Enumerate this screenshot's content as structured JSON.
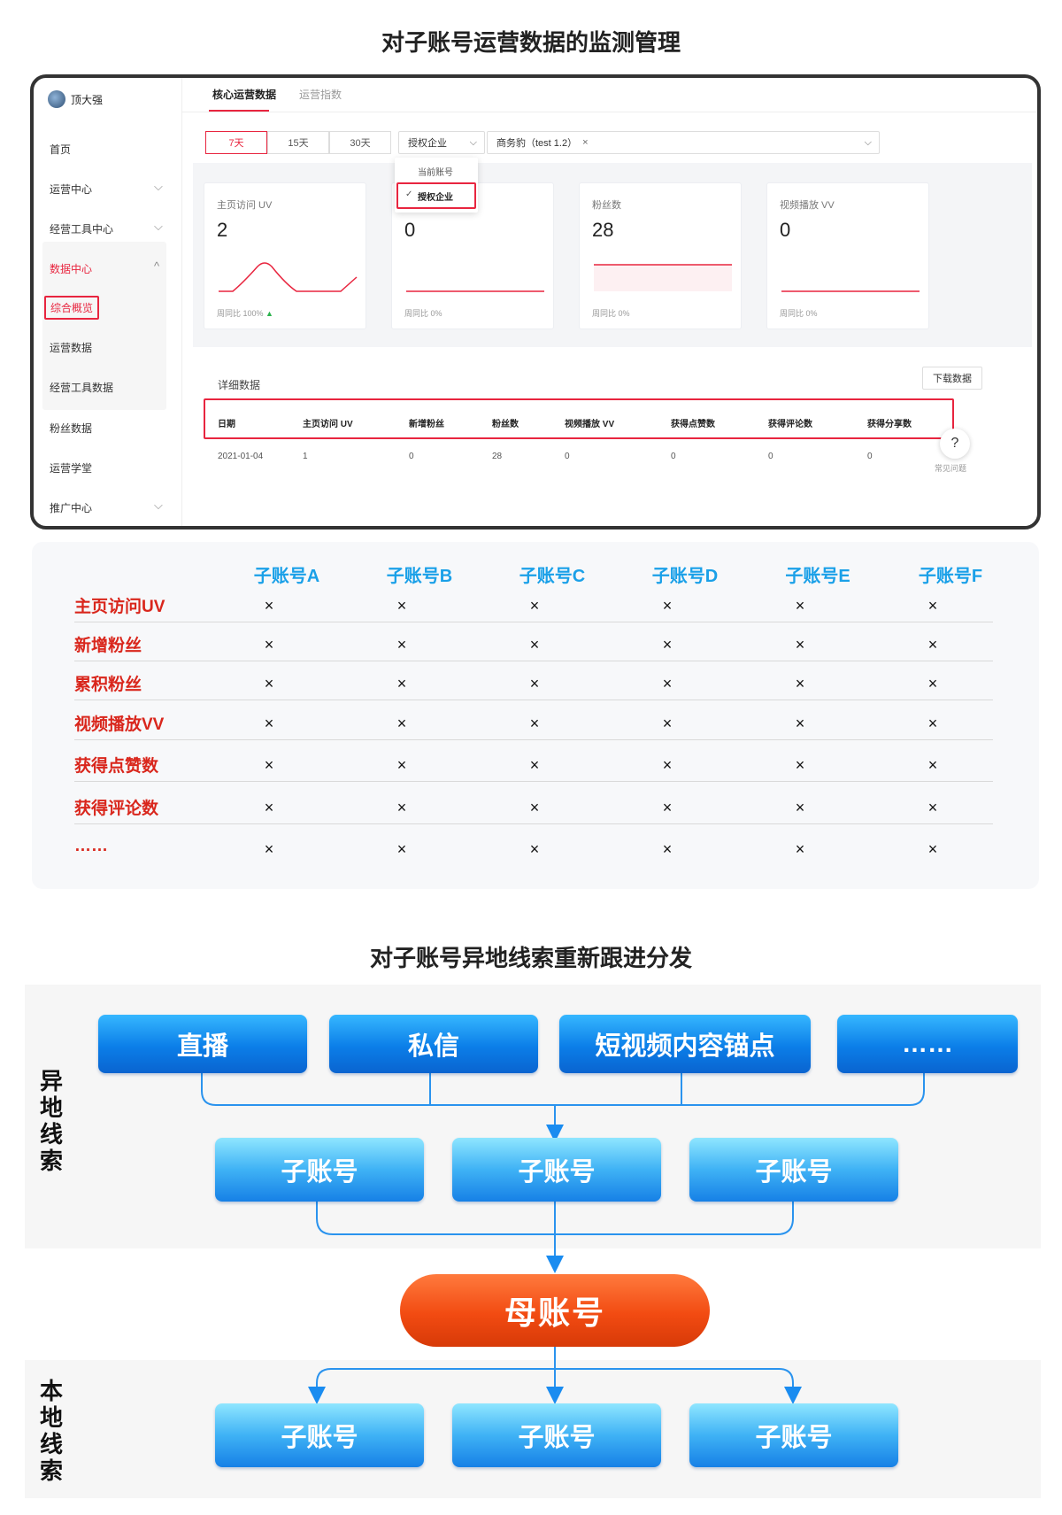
{
  "section1_title": "对子账号运营数据的监测管理",
  "section2_title": "对子账号异地线索重新跟进分发",
  "app": {
    "user_name": "顶大强",
    "sidebar": {
      "home": "首页",
      "ops_center": "运营中心",
      "tools_center": "经营工具中心",
      "data_center": "数据中心",
      "overview": "综合概览",
      "ops_data": "运营数据",
      "tools_data": "经营工具数据",
      "fans_data": "粉丝数据",
      "ops_school": "运营学堂",
      "promo_center": "推广中心"
    },
    "tabs": [
      "核心运营数据",
      "运营指数"
    ],
    "ranges": [
      "7天",
      "15天",
      "30天"
    ],
    "account_select": "授权企业",
    "account_options": [
      "当前账号",
      "授权企业"
    ],
    "enterprise_tag": "商务豹（test 1.2）",
    "metrics": [
      {
        "label": "主页访问 UV",
        "value": "2",
        "foot": "周同比 100%"
      },
      {
        "label": "新",
        "value": "0",
        "foot": "周同比 0%"
      },
      {
        "label": "粉丝数",
        "value": "28",
        "foot": "周同比 0%"
      },
      {
        "label": "视频播放 VV",
        "value": "0",
        "foot": "周同比 0%"
      }
    ],
    "detail_title": "详细数据",
    "download_label": "下载数据",
    "columns": [
      "日期",
      "主页访问 UV",
      "新增粉丝",
      "粉丝数",
      "视频播放 VV",
      "获得点赞数",
      "获得评论数",
      "获得分享数"
    ],
    "rows": [
      [
        "2021-01-04",
        "1",
        "0",
        "28",
        "0",
        "0",
        "0",
        "0"
      ]
    ],
    "help_label": "常见问题",
    "colors": {
      "accent": "#e8253f"
    }
  },
  "matrix": {
    "accounts": [
      "子账号A",
      "子账号B",
      "子账号C",
      "子账号D",
      "子账号E",
      "子账号F"
    ],
    "metrics": [
      "主页访问UV",
      "新增粉丝",
      "累积粉丝",
      "视频播放VV",
      "获得点赞数",
      "获得评论数",
      "……"
    ],
    "cell": "×"
  },
  "flow": {
    "remote_label": "异地线索",
    "local_label": "本地线索",
    "sources": [
      "直播",
      "私信",
      "短视频内容锚点",
      "……"
    ],
    "sub_account": "子账号",
    "mother_account": "母账号",
    "colors": {
      "blue": "#0b7ee8",
      "orange": "#f24b12"
    }
  }
}
